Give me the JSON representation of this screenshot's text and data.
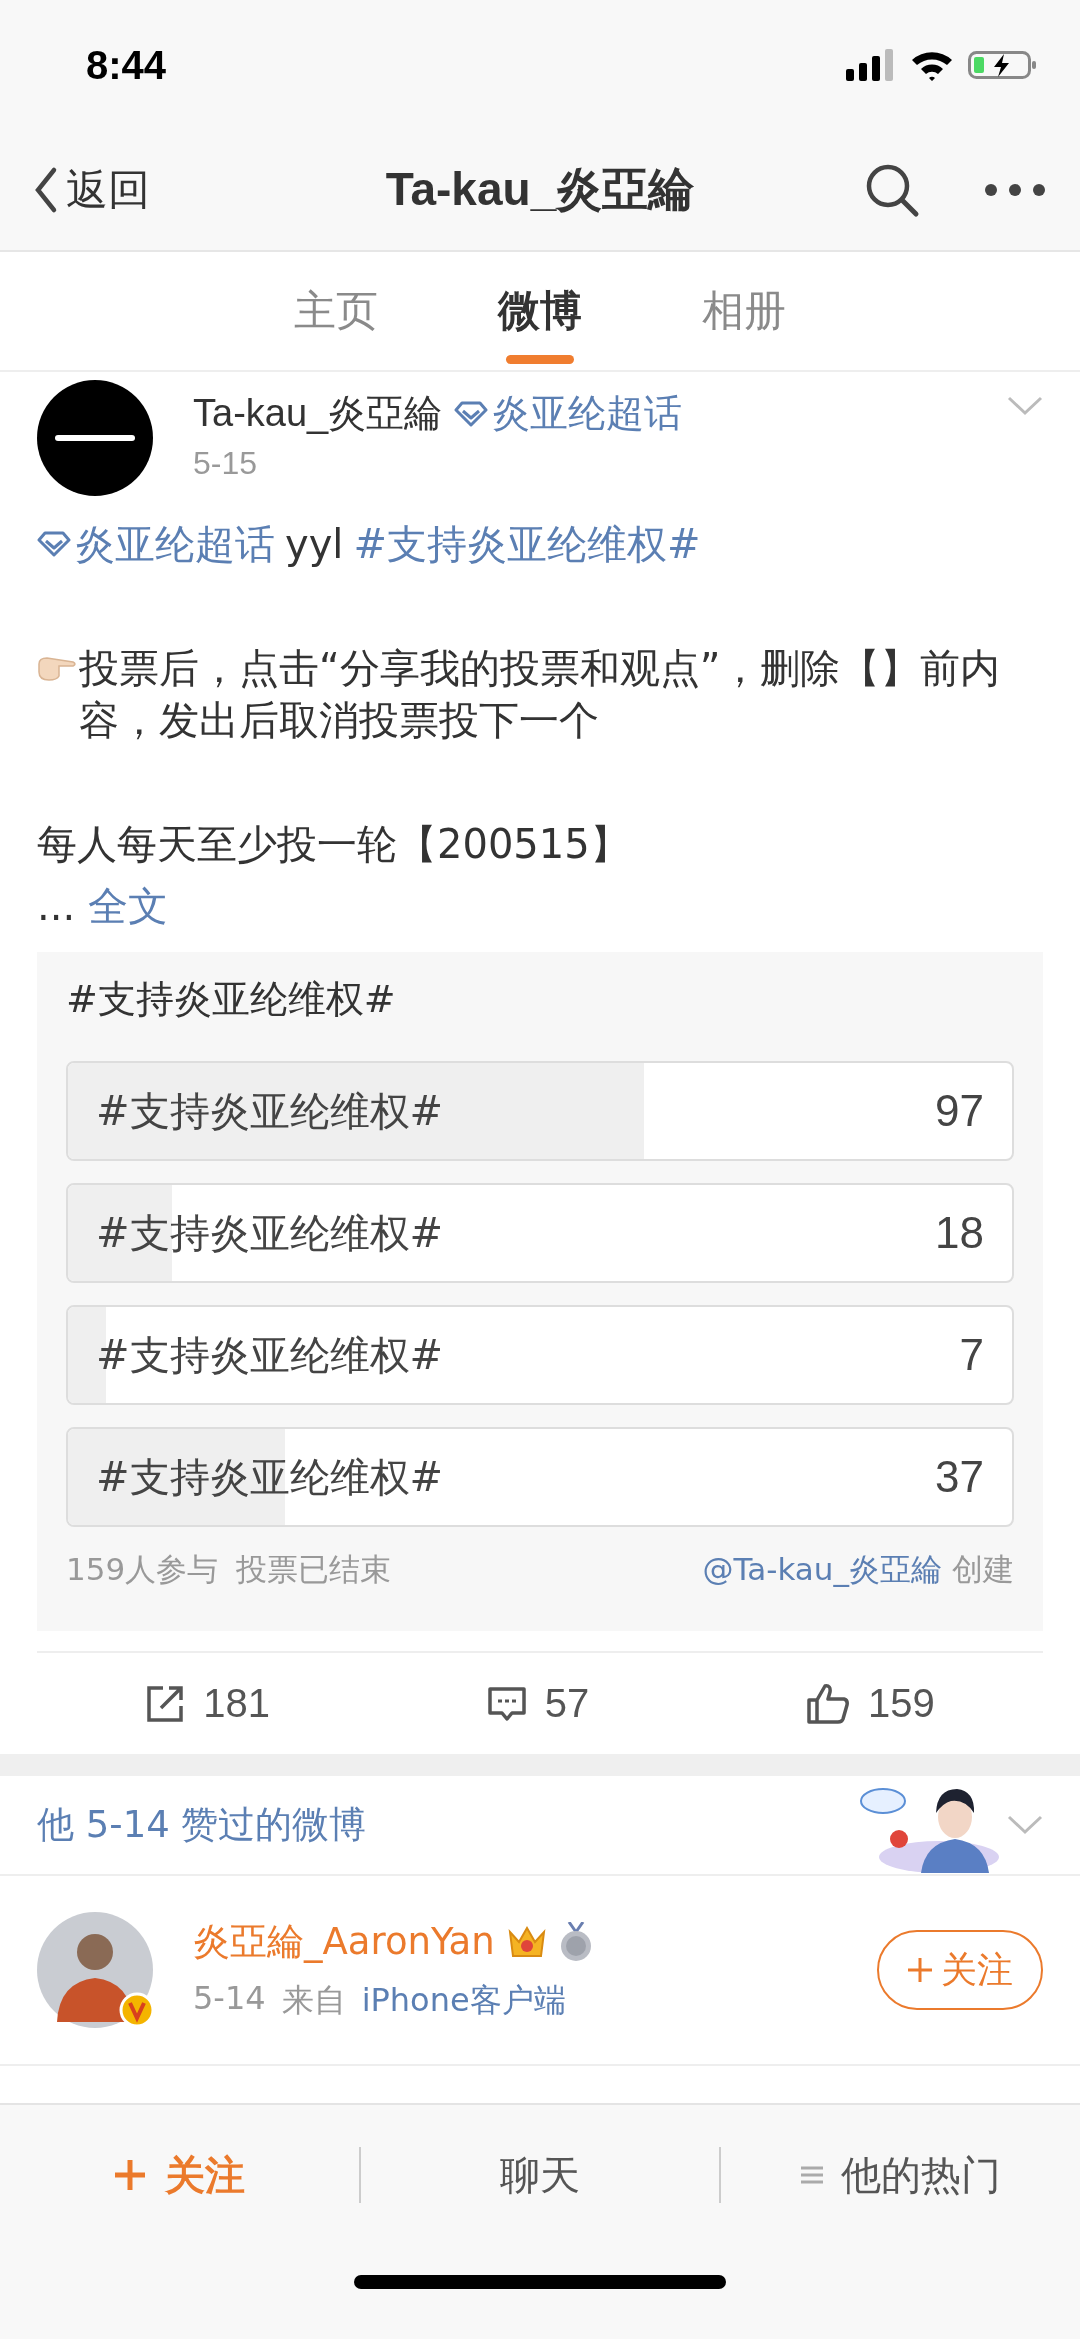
{
  "status_bar": {
    "time": "8:44"
  },
  "nav": {
    "back": "返回",
    "title": "Ta-kau_炎亞綸"
  },
  "tabs": [
    {
      "label": "主页",
      "selected": false
    },
    {
      "label": "微博",
      "selected": true
    },
    {
      "label": "相册",
      "selected": false
    }
  ],
  "post": {
    "author": "Ta-kau_炎亞綸",
    "topic": "炎亚纶超话",
    "date": "5-15",
    "lines": [
      [
        {
          "kind": "topic",
          "text": "炎亚纶超话"
        },
        {
          "kind": "plain",
          "text": "yyl"
        },
        {
          "kind": "hashtag",
          "text": "#支持炎亚纶维权#"
        }
      ]
    ],
    "paragraphs": [
      {
        "kind": "pointer",
        "text": "投票后，点击“分享我的投票和观点”，删除【】前内容，发出后取消投票投下一个"
      },
      {
        "kind": "plain",
        "text": "每人每天至少投一轮【200515】"
      }
    ],
    "ellipsis": "...",
    "more": "全文",
    "poll": {
      "title": "#支持炎亚纶维权#",
      "options": [
        {
          "label": "#支持炎亚纶维权#",
          "count": "97",
          "level": 0.61
        },
        {
          "label": "#支持炎亚纶维权#",
          "count": "18",
          "level": 0.11
        },
        {
          "label": "#支持炎亚纶维权#",
          "count": "7",
          "level": 0.04
        },
        {
          "label": "#支持炎亚纶维权#",
          "count": "37",
          "level": 0.23
        }
      ],
      "participants": "159人参与",
      "status": "投票已结束",
      "creator": "@Ta-kau_炎亞綸",
      "created": "创建"
    },
    "actions": [
      {
        "kind": "repost",
        "count": "181"
      },
      {
        "kind": "comment",
        "count": "57"
      },
      {
        "kind": "like",
        "count": "159"
      }
    ]
  },
  "liked": {
    "title": "他 5-14 赞过的微博"
  },
  "liked_post": {
    "author": "炎亞綸_AaronYan",
    "date": "5-14",
    "source_prefix": "来自",
    "source": "iPhone客户端",
    "follow": "关注"
  },
  "bottom_bar": [
    {
      "kind": "follow",
      "label": "关注"
    },
    {
      "kind": "chat",
      "label": "聊天"
    },
    {
      "kind": "hot",
      "label": "他的热门"
    }
  ]
}
